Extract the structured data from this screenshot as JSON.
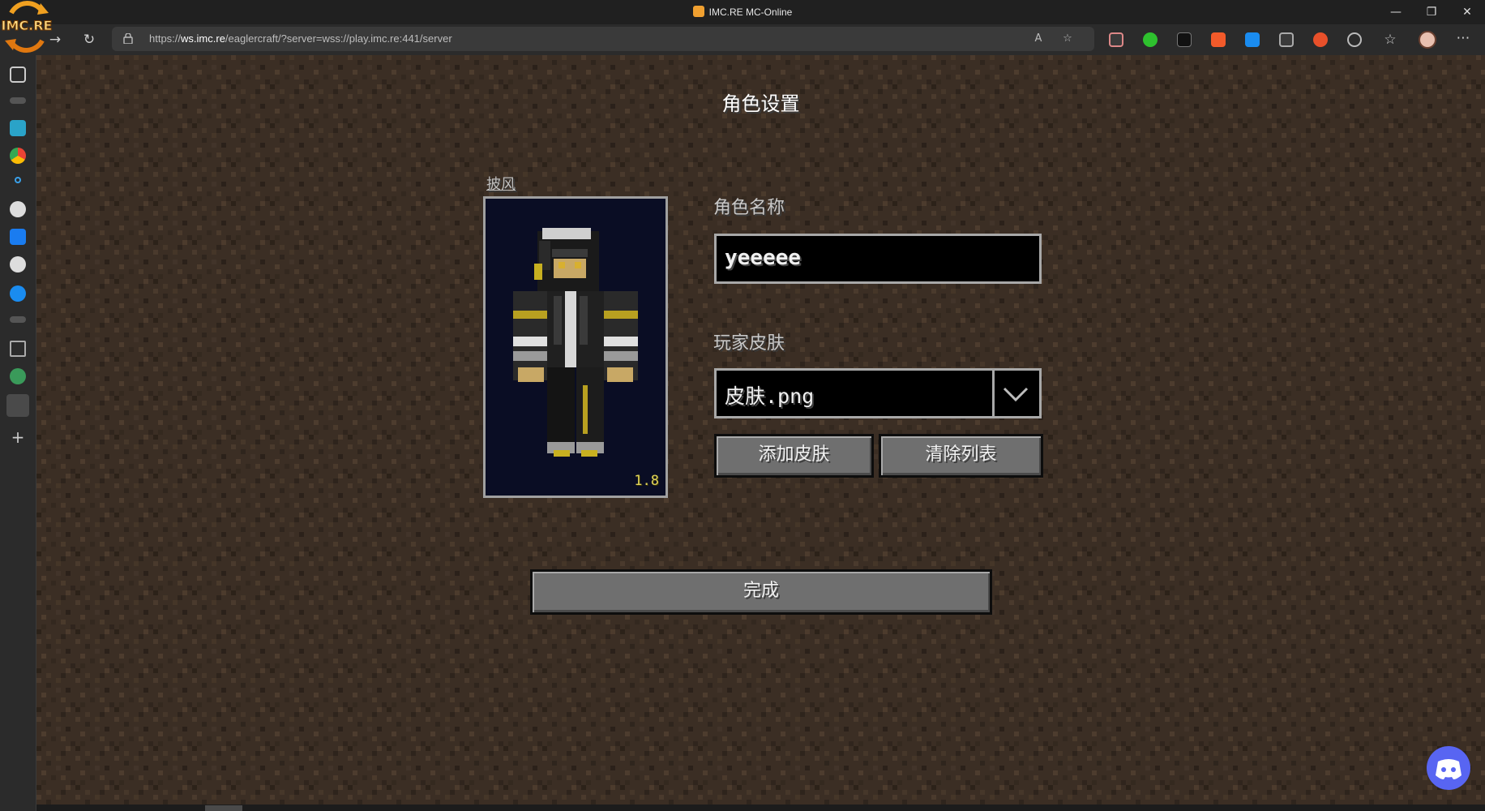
{
  "window": {
    "title": "IMC.RE MC-Online",
    "minimize_glyph": "—",
    "restore_glyph": "❐",
    "close_glyph": "✕"
  },
  "logo": {
    "text": "IMC.RE"
  },
  "browser": {
    "back_glyph": "←",
    "forward_glyph": "→",
    "reload_glyph": "↻",
    "url_prefix": "https://",
    "url_host": "ws.imc.re",
    "url_rest": "/eaglercraft/?server=wss://play.imc.re:441/server",
    "read_aloud_glyph": "A",
    "favorite_glyph": "☆",
    "more_glyph": "⋯"
  },
  "game": {
    "screen_title": "角色设置",
    "cape_link": "披风",
    "version_badge": "1.8",
    "name_label": "角色名称",
    "name_value": "yeeeee",
    "skin_label": "玩家皮肤",
    "skin_value": "皮肤.png",
    "add_skin_button": "添加皮肤",
    "clear_list_button": "清除列表",
    "done_button": "完成"
  },
  "colors": {
    "background_dirt": "#3c2f24",
    "button_face": "#6f6f6f",
    "discord": "#5865f2"
  }
}
